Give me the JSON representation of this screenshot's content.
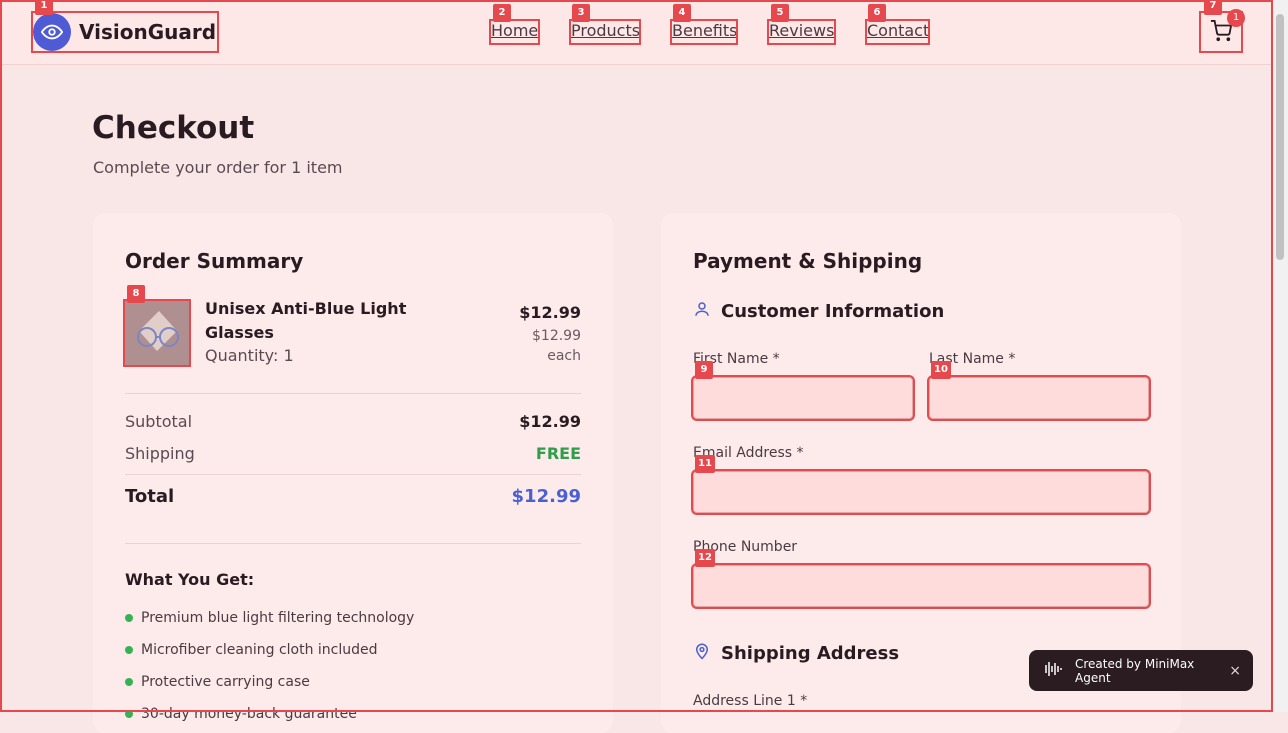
{
  "brand": {
    "name": "VisionGuard",
    "accent": "#4f5bd5"
  },
  "nav": {
    "home": "Home",
    "products": "Products",
    "benefits": "Benefits",
    "reviews": "Reviews",
    "contact": "Contact"
  },
  "cart": {
    "count": "1"
  },
  "page": {
    "title": "Checkout",
    "subtitle": "Complete your order for 1 item"
  },
  "order": {
    "heading": "Order Summary",
    "item": {
      "name": "Unisex Anti-Blue Light Glasses",
      "quantity": "Quantity: 1",
      "price": "$12.99",
      "each": "$12.99 each"
    },
    "subtotal_label": "Subtotal",
    "subtotal": "$12.99",
    "shipping_label": "Shipping",
    "shipping": "FREE",
    "total_label": "Total",
    "total": "$12.99",
    "get_title": "What You Get:",
    "benefits": [
      "Premium blue light filtering technology",
      "Microfiber cleaning cloth included",
      "Protective carrying case",
      "30-day money-back guarantee"
    ]
  },
  "payment": {
    "heading": "Payment & Shipping",
    "customer_heading": "Customer Information",
    "first_name_label": "First Name *",
    "first_name_value": "",
    "last_name_label": "Last Name *",
    "last_name_value": "",
    "email_label": "Email Address *",
    "email_value": "",
    "phone_label": "Phone Number",
    "phone_value": "",
    "shipping_heading": "Shipping Address",
    "address1_label": "Address Line 1 *"
  },
  "toast": {
    "text": "Created by MiniMax Agent",
    "close": "×"
  },
  "markers": [
    "1",
    "2",
    "3",
    "4",
    "5",
    "6",
    "7",
    "8",
    "9",
    "10",
    "11",
    "12"
  ]
}
